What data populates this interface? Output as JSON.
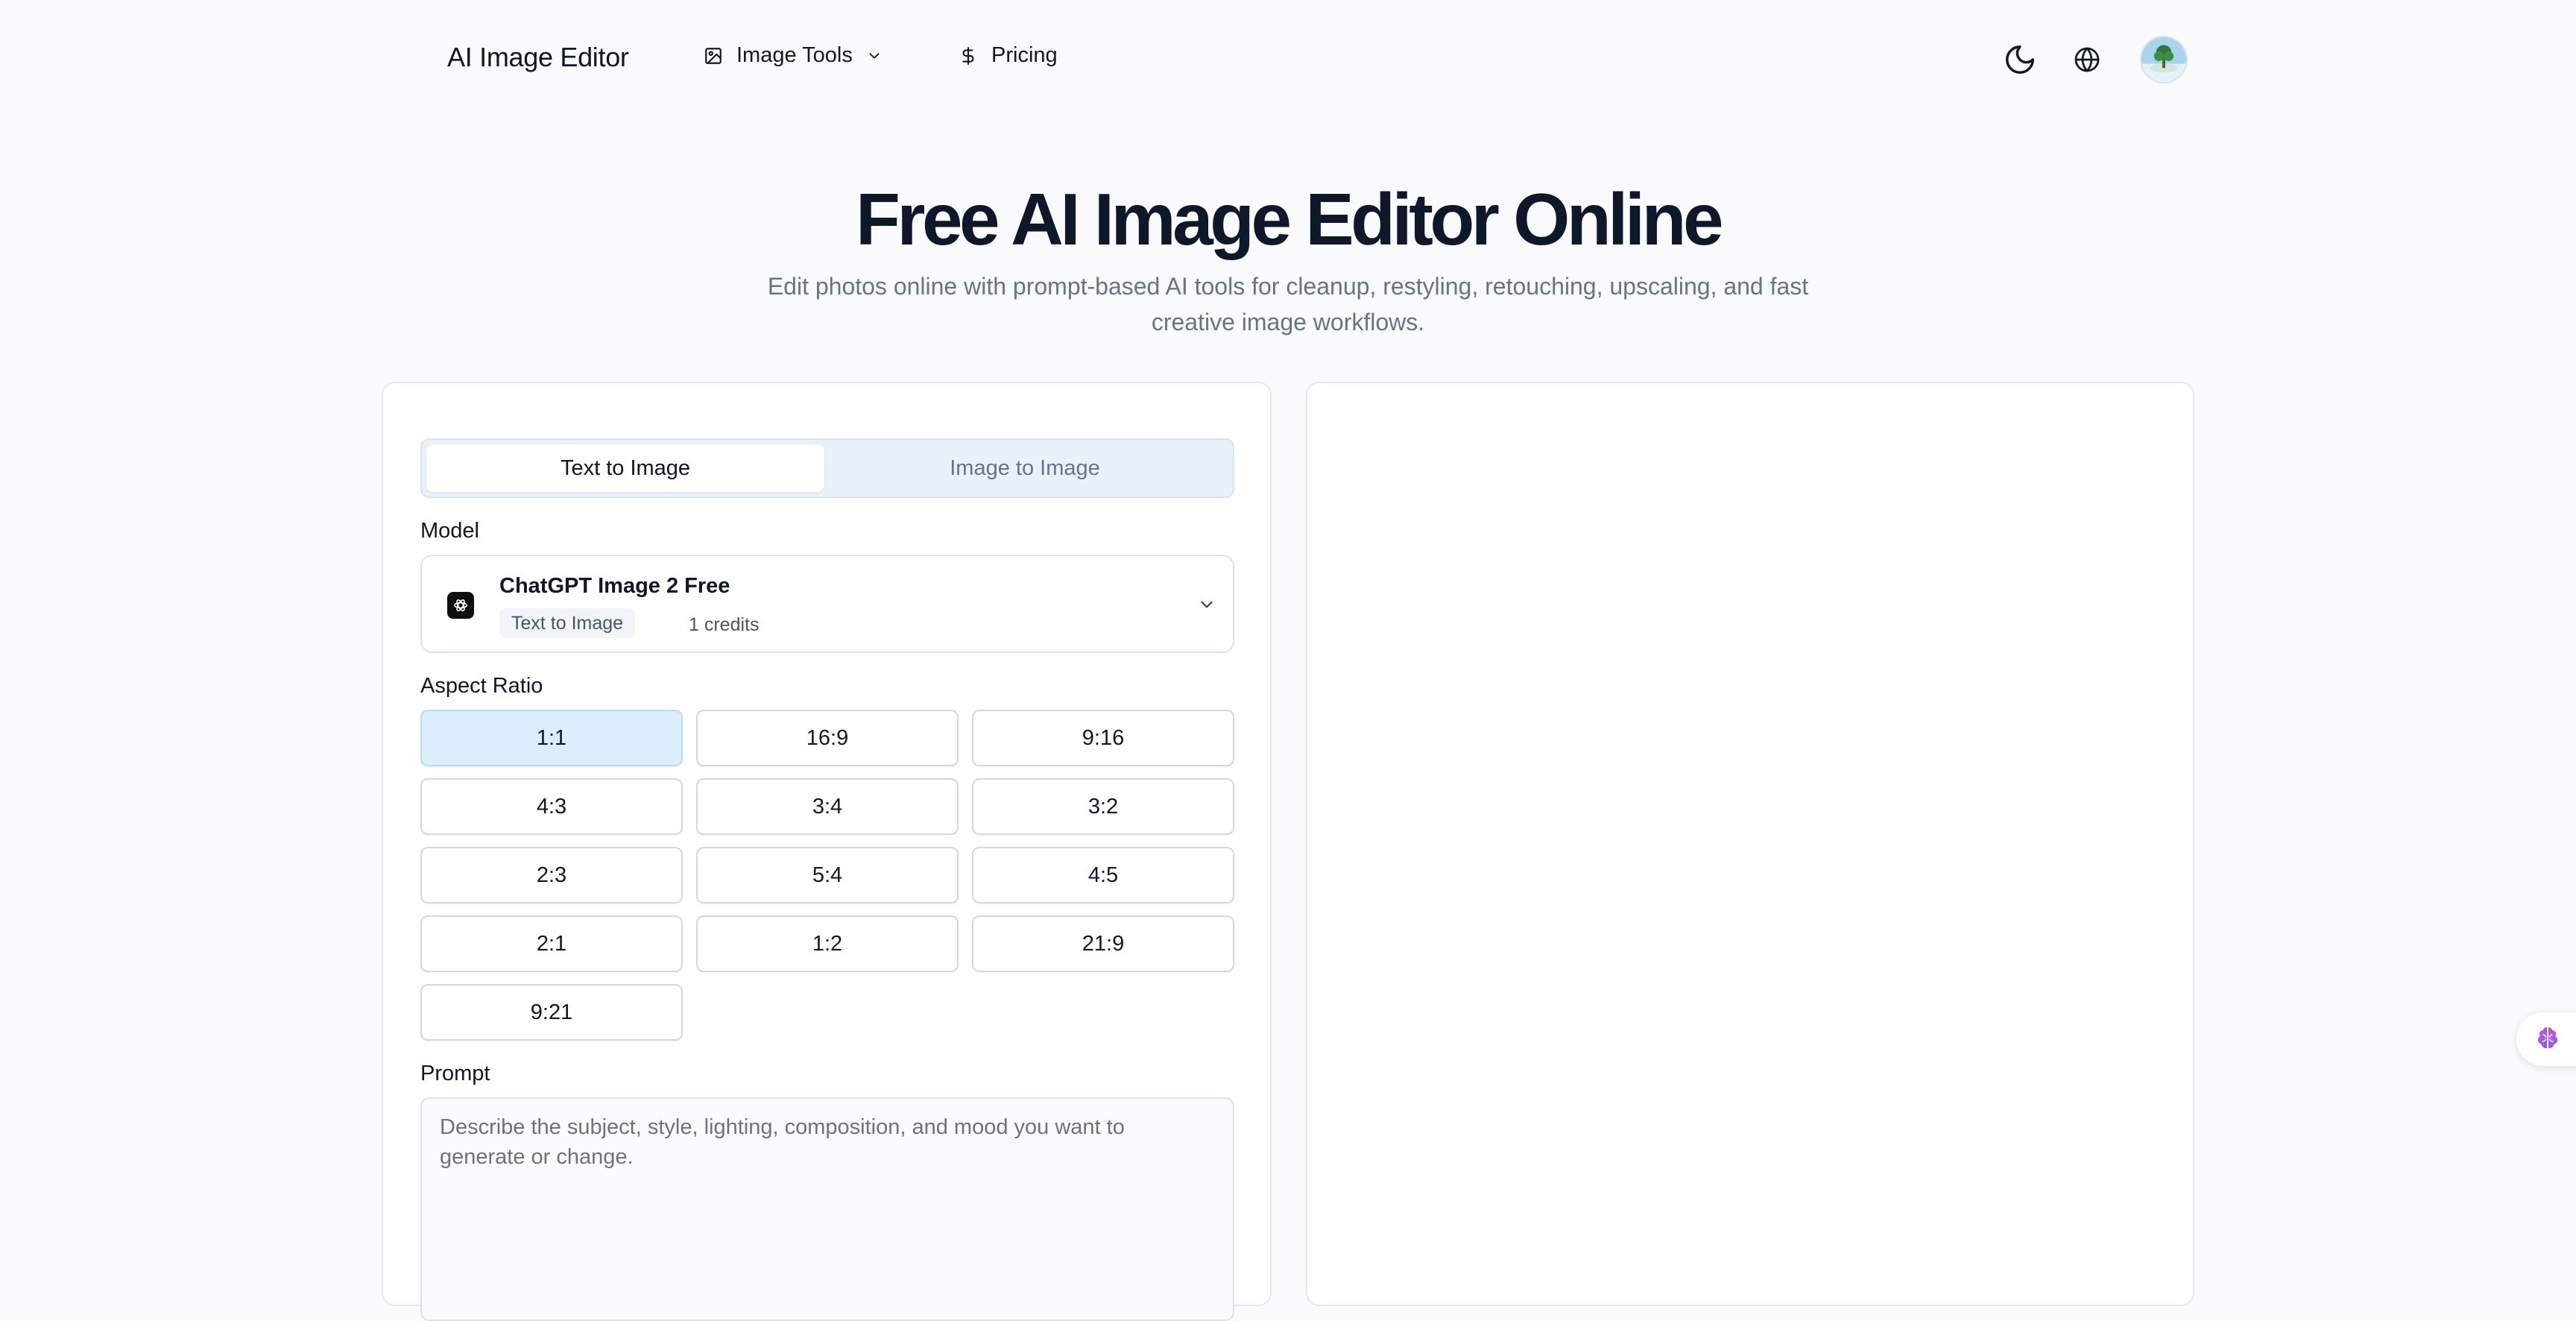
{
  "header": {
    "brand": "AI Image Editor",
    "nav": {
      "image_tools": {
        "label": "Image Tools",
        "icon": "image-icon"
      },
      "pricing": {
        "label": "Pricing",
        "icon": "dollar-icon"
      }
    },
    "icons": [
      "moon-icon",
      "globe-icon",
      "avatar"
    ]
  },
  "hero": {
    "title": "Free AI Image Editor Online",
    "subtitle_line1": "Edit photos online with prompt-based AI tools for cleanup, restyling, retouching, upscaling, and fast",
    "subtitle_line2": "creative image workflows."
  },
  "editor": {
    "tabs": [
      {
        "label": "Text to Image",
        "active": true
      },
      {
        "label": "Image to Image",
        "active": false
      }
    ],
    "model": {
      "label": "Model",
      "name": "ChatGPT Image 2 Free",
      "tag": "Text to Image",
      "credits": "1 credits"
    },
    "aspect_ratio": {
      "label": "Aspect Ratio",
      "options": [
        "1:1",
        "16:9",
        "9:16",
        "4:3",
        "3:4",
        "3:2",
        "2:3",
        "5:4",
        "4:5",
        "2:1",
        "1:2",
        "21:9",
        "9:21"
      ],
      "selected": "1:1"
    },
    "prompt": {
      "label": "Prompt",
      "placeholder": "Describe the subject, style, lighting, composition, and mood you want to generate or change."
    }
  },
  "colors": {
    "background": "#f8fafc",
    "selected_ratio": "#dbeefb",
    "tab_bar": "#eaf1fb",
    "text_primary": "#0f172a",
    "text_muted": "#64748b"
  }
}
